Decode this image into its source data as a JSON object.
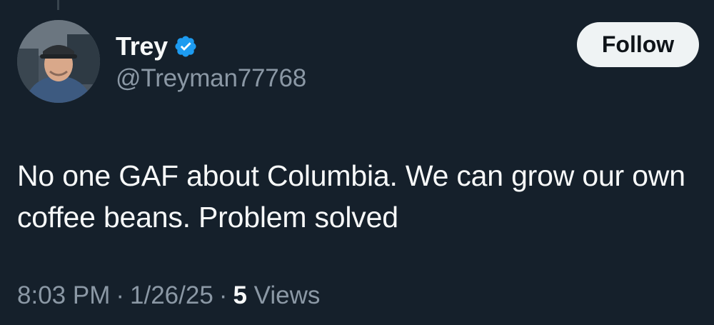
{
  "tweet": {
    "author": {
      "name": "Trey",
      "handle": "@Treyman77768",
      "verified": true,
      "verified_color": "#1d9bf0"
    },
    "follow_label": "Follow",
    "text": "No one GAF about Columbia. We can grow our own coffee beans. Problem solved",
    "time": "8:03 PM",
    "date": "1/26/25",
    "views_count": "5",
    "views_label": "Views"
  },
  "icons": {
    "verified": "verified-badge-icon",
    "avatar": "profile-avatar"
  },
  "colors": {
    "background": "#15202b",
    "text": "#f7f9f9",
    "secondary_text": "#8b98a5",
    "follow_bg": "#eff3f4"
  }
}
